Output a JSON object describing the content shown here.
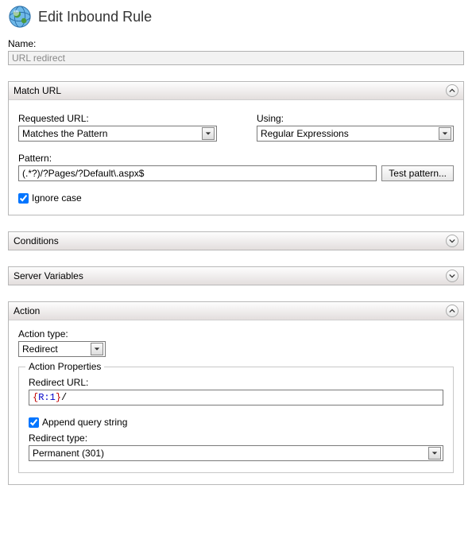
{
  "header": {
    "title": "Edit Inbound Rule"
  },
  "name": {
    "label": "Name:",
    "value": "URL redirect"
  },
  "match": {
    "title": "Match URL",
    "requested_label": "Requested URL:",
    "requested_value": "Matches the Pattern",
    "using_label": "Using:",
    "using_value": "Regular Expressions",
    "pattern_label": "Pattern:",
    "pattern_value": "(.*?)/?Pages/?Default\\.aspx$",
    "test_button": "Test pattern...",
    "ignore_case_label": "Ignore case",
    "ignore_case_checked": true
  },
  "conditions": {
    "title": "Conditions"
  },
  "server_vars": {
    "title": "Server Variables"
  },
  "action": {
    "title": "Action",
    "type_label": "Action type:",
    "type_value": "Redirect",
    "props_legend": "Action Properties",
    "redirect_url_label": "Redirect URL:",
    "redirect_url_brace_open": "{",
    "redirect_url_inner": "R:1",
    "redirect_url_brace_close": "}",
    "redirect_url_tail": "/",
    "append_label": "Append query string",
    "append_checked": true,
    "redirect_type_label": "Redirect type:",
    "redirect_type_value": "Permanent (301)"
  }
}
